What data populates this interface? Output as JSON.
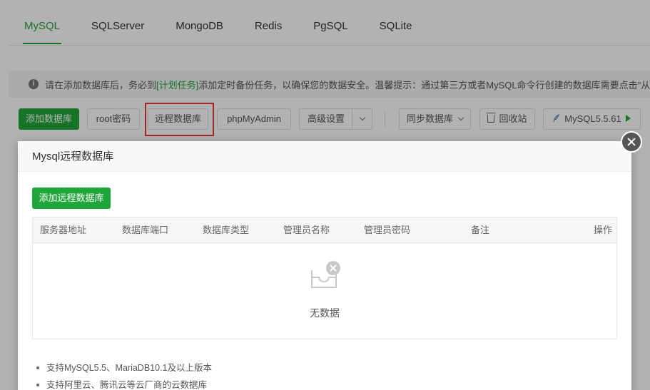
{
  "tabs": [
    {
      "label": "MySQL",
      "active": true
    },
    {
      "label": "SQLServer"
    },
    {
      "label": "MongoDB"
    },
    {
      "label": "Redis"
    },
    {
      "label": "PgSQL"
    },
    {
      "label": "SQLite"
    }
  ],
  "alert": {
    "prefix": "请在添加数据库后，务必到",
    "link": "[计划任务]",
    "suffix": "添加定时备份任务，以确保您的数据安全。温馨提示：通过第三方或者MySQL命令行创建的数据库需要点击\"从"
  },
  "toolbar": {
    "add_db": "添加数据库",
    "root_password": "root密码",
    "remote_db": "远程数据库",
    "phpmyadmin": "phpMyAdmin",
    "advanced": "高级设置",
    "sync_db": "同步数据库",
    "recycle_bin": "回收站",
    "mysql_version": "MySQL5.5.61"
  },
  "modal": {
    "title": "Mysql远程数据库",
    "add_button": "添加远程数据库",
    "columns": [
      "服务器地址",
      "数据库端口",
      "数据库类型",
      "管理员名称",
      "管理员密码",
      "备注",
      "操作"
    ],
    "empty_text": "无数据",
    "notes": [
      "支持MySQL5.5、MariaDB10.1及以上版本",
      "支持阿里云、腾讯云等云厂商的云数据库"
    ]
  },
  "colors": {
    "accent": "#20a53a",
    "highlight": "#e53935"
  }
}
